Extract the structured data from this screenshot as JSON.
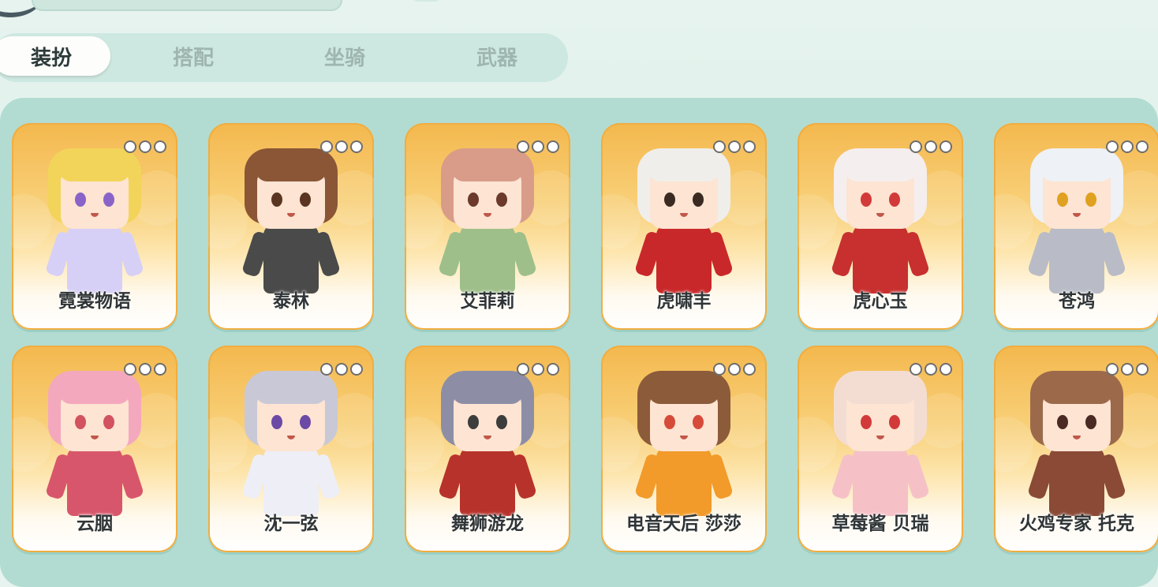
{
  "tabs": [
    {
      "label": "装扮",
      "active": true
    },
    {
      "label": "搭配",
      "active": false
    },
    {
      "label": "坐骑",
      "active": false
    },
    {
      "label": "武器",
      "active": false
    }
  ],
  "cards": [
    {
      "name": "霓裳物语",
      "hair": "#f3d45a",
      "outfit": "#d7d0f6",
      "eyes": "#8a63c9"
    },
    {
      "name": "泰林",
      "hair": "#8a5636",
      "outfit": "#4a4a4a",
      "eyes": "#5a3522"
    },
    {
      "name": "艾菲莉",
      "hair": "#d99c88",
      "outfit": "#9fbf8a",
      "eyes": "#6b3a2c"
    },
    {
      "name": "虎啸丰",
      "hair": "#f0eeea",
      "outfit": "#c9282a",
      "eyes": "#3a2a22"
    },
    {
      "name": "虎心玉",
      "hair": "#f5eeee",
      "outfit": "#c7302f",
      "eyes": "#d23a3a"
    },
    {
      "name": "苍鸿",
      "hair": "#eef1f5",
      "outfit": "#b9bcc6",
      "eyes": "#e0a020"
    },
    {
      "name": "云胭",
      "hair": "#f4a8bd",
      "outfit": "#d8566b",
      "eyes": "#d2525f"
    },
    {
      "name": "沈一弦",
      "hair": "#c9c8d6",
      "outfit": "#eeeef6",
      "eyes": "#6b4aa6"
    },
    {
      "name": "舞狮游龙",
      "hair": "#8d8ea6",
      "outfit": "#b8322c",
      "eyes": "#3d3d3d"
    },
    {
      "name": "电音天后 莎莎",
      "hair": "#8c5b3a",
      "outfit": "#f29a2a",
      "eyes": "#d64a3a"
    },
    {
      "name": "草莓酱 贝瑞",
      "hair": "#f3ddd2",
      "outfit": "#f5c1c7",
      "eyes": "#d23a3a"
    },
    {
      "name": "火鸡专家 托克",
      "hair": "#9c6a4a",
      "outfit": "#8a4a36",
      "eyes": "#4a2a22"
    }
  ]
}
